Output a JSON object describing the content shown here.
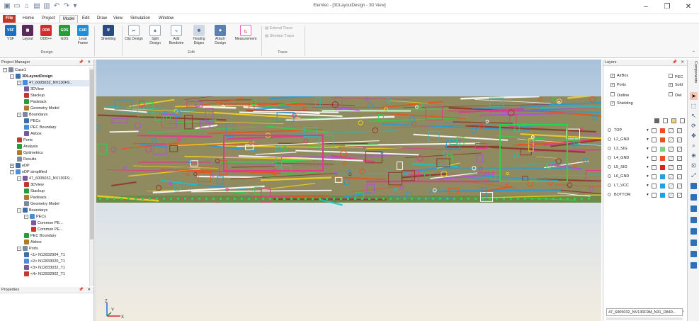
{
  "window": {
    "title": "Elemtec - [3DLayoutDesign - 3D View]",
    "controls": [
      "–",
      "❐",
      "✕"
    ]
  },
  "menu": [
    "File",
    "Home",
    "Project",
    "Model",
    "Edit",
    "Draw",
    "View",
    "Simulation",
    "Window"
  ],
  "ribbon": {
    "design_group": {
      "label": "Design",
      "buttons": [
        {
          "label": "VSF",
          "icon": "VSF",
          "color": "#1e6fbf"
        },
        {
          "label": "Layout",
          "icon": "",
          "color": "#5a2a5a"
        },
        {
          "label": "ODB++",
          "icon": "ODB",
          "color": "#d12b2b"
        },
        {
          "label": "GDS",
          "icon": "GDS",
          "color": "#2a9a3a"
        },
        {
          "label": "Lead Frame",
          "icon": "CAD",
          "color": "#1d8fd6"
        }
      ]
    },
    "shielding": {
      "label": "Shielding"
    },
    "edit_group": {
      "label": "Edit",
      "buttons": [
        "Clip Design",
        "Split Design",
        "Add Bondwire",
        "Healing Edges",
        "Attach Design",
        "Measurement"
      ]
    },
    "trace_group": {
      "label": "Trace",
      "buttons": [
        "Extend Trace",
        "Shorten Trace"
      ]
    }
  },
  "project_manager": {
    "title": "Project Manager",
    "tree": [
      {
        "label": "Case1",
        "depth": 0,
        "exp": "-"
      },
      {
        "label": "3DLayoutDesign",
        "depth": 1,
        "exp": "-",
        "bold": true
      },
      {
        "label": "47_6005032_NV130F9...",
        "depth": 2,
        "exp": "-",
        "selected": true
      },
      {
        "label": "3DView",
        "depth": 3
      },
      {
        "label": "Stackup",
        "depth": 3
      },
      {
        "label": "Padstack",
        "depth": 3
      },
      {
        "label": "Geometry Model",
        "depth": 3
      },
      {
        "label": "Boundarys",
        "depth": 2,
        "exp": "-"
      },
      {
        "label": "PECs",
        "depth": 3
      },
      {
        "label": "PEC Boundary",
        "depth": 3
      },
      {
        "label": "Airbox",
        "depth": 3
      },
      {
        "label": "Ports",
        "depth": 2
      },
      {
        "label": "Analysis",
        "depth": 2
      },
      {
        "label": "Optimetrics",
        "depth": 2
      },
      {
        "label": "Results",
        "depth": 2
      },
      {
        "label": "eDP",
        "depth": 1,
        "exp": "+"
      },
      {
        "label": "eDP simplified",
        "depth": 1,
        "exp": "-"
      },
      {
        "label": "47_6005032_NV130F9...",
        "depth": 2,
        "exp": "-"
      },
      {
        "label": "3DView",
        "depth": 3
      },
      {
        "label": "Stackup",
        "depth": 3
      },
      {
        "label": "Padstack",
        "depth": 3
      },
      {
        "label": "Geometry Model",
        "depth": 3
      },
      {
        "label": "Boundarys",
        "depth": 2,
        "exp": "-"
      },
      {
        "label": "PECs",
        "depth": 3,
        "exp": "-"
      },
      {
        "label": "Common PE...",
        "depth": 4
      },
      {
        "label": "Common PE...",
        "depth": 4
      },
      {
        "label": "PEC Boundary",
        "depth": 3
      },
      {
        "label": "Airbox",
        "depth": 3
      },
      {
        "label": "Ports",
        "depth": 2,
        "exp": "-"
      },
      {
        "label": "<1> N12832904_T1",
        "depth": 3
      },
      {
        "label": "<2> N12833020_T1",
        "depth": 3
      },
      {
        "label": "<3> N12833032_T1",
        "depth": 3
      },
      {
        "label": "<4> N12832902_T1",
        "depth": 3
      }
    ]
  },
  "properties": {
    "title": "Properties"
  },
  "layers": {
    "title": "Layers",
    "checks": [
      {
        "label": "AirBox",
        "checked": true
      },
      {
        "label": "PEC",
        "checked": false
      },
      {
        "label": "Ports",
        "checked": true
      },
      {
        "label": "Sold",
        "checked": true
      },
      {
        "label": "Outline",
        "checked": false
      },
      {
        "label": "Diel",
        "checked": false
      },
      {
        "label": "Shielding",
        "checked": true
      }
    ],
    "rows": [
      {
        "name": "TOP",
        "color": "#e8521e"
      },
      {
        "name": "L2_GND",
        "color": "#e8521e"
      },
      {
        "name": "L3_SIG",
        "color": "#7ed37e"
      },
      {
        "name": "L4_GND",
        "color": "#e8521e"
      },
      {
        "name": "L5_SIG",
        "color": "#e02020"
      },
      {
        "name": "L6_GND",
        "color": "#20a0e0"
      },
      {
        "name": "L7_VCC",
        "color": "#20a0e0"
      },
      {
        "name": "BOTTOM",
        "color": "#20a0e0"
      }
    ],
    "footer": "47_6005032_NV130F9M_N31_D840..."
  },
  "side_tab": "Components",
  "axis": {
    "x": "X",
    "y": "Y",
    "z": "Z"
  }
}
